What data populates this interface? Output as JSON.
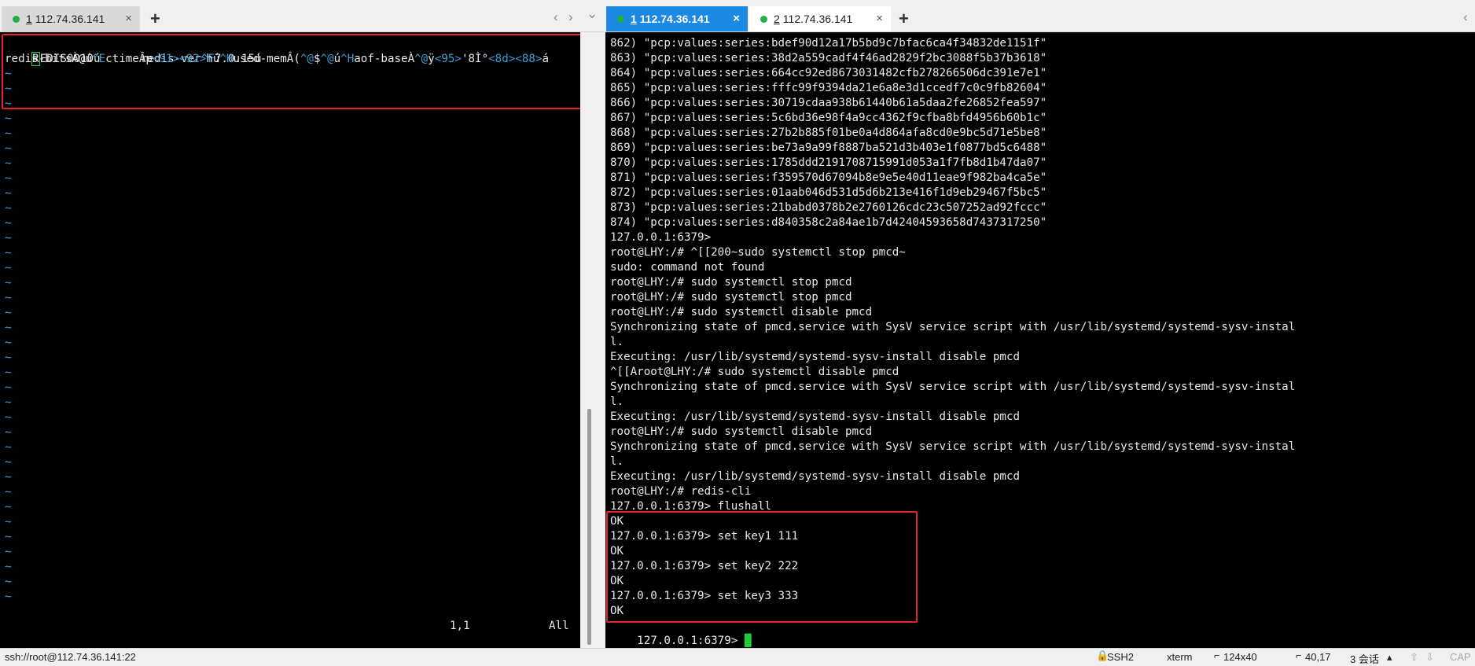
{
  "left_tabs": [
    {
      "num": "1",
      "host": "112.74.36.141",
      "close": "×"
    }
  ],
  "right_tabs": [
    {
      "num": "1",
      "host": "112.74.36.141",
      "close": "×"
    },
    {
      "num": "2",
      "host": "112.74.36.141",
      "close": "×"
    }
  ],
  "add_tab": "+",
  "nav": {
    "prev": "‹",
    "next": "›",
    "menu": "⌄"
  },
  "left_term": {
    "line1_a": "R",
    "line1_b": "EDIS0010ú      redis-ver",
    "line1_c": "^F",
    "line1_d": "7.0.15ú",
    "line2_segments": [
      {
        "t": "redis-bitsÀ@ú",
        "c": false
      },
      {
        "t": "^E",
        "c": true
      },
      {
        "t": "ctimeÂp",
        "c": false
      },
      {
        "t": "<91><92>",
        "c": true
      },
      {
        "t": "hú",
        "c": false
      },
      {
        "t": "^H",
        "c": true
      },
      {
        "t": "used-memÂ(",
        "c": false
      },
      {
        "t": "^@",
        "c": true
      },
      {
        "t": "$",
        "c": false
      },
      {
        "t": "^@",
        "c": true
      },
      {
        "t": "ú",
        "c": false
      },
      {
        "t": "^H",
        "c": true
      },
      {
        "t": "aof-baseÀ",
        "c": false
      },
      {
        "t": "^@",
        "c": true
      },
      {
        "t": "ÿ",
        "c": false
      },
      {
        "t": "<95>",
        "c": true
      },
      {
        "t": "'8Ì°",
        "c": false
      },
      {
        "t": "<8d><88>",
        "c": true
      },
      {
        "t": "á",
        "c": false
      }
    ],
    "tilde": "~",
    "tilde_count": 36,
    "ruler_pos": "1,1",
    "ruler_all": "All"
  },
  "right_term": {
    "lines": [
      "862) \"pcp:values:series:bdef90d12a17b5bd9c7bfac6ca4f34832de1151f\"",
      "863) \"pcp:values:series:38d2a559cadf4f46ad2829f2bc3088f5b37b3618\"",
      "864) \"pcp:values:series:664cc92ed8673031482cfb278266506dc391e7e1\"",
      "865) \"pcp:values:series:fffc99f9394da21e6a8e3d1ccedf7c0c9fb82604\"",
      "866) \"pcp:values:series:30719cdaa938b61440b61a5daa2fe26852fea597\"",
      "867) \"pcp:values:series:5c6bd36e98f4a9cc4362f9cfba8bfd4956b60b1c\"",
      "868) \"pcp:values:series:27b2b885f01be0a4d864afa8cd0e9bc5d71e5be8\"",
      "869) \"pcp:values:series:be73a9a99f8887ba521d3b403e1f0877bd5c6488\"",
      "870) \"pcp:values:series:1785ddd2191708715991d053a1f7fb8d1b47da07\"",
      "871) \"pcp:values:series:f359570d67094b8e9e5e40d11eae9f982ba4ca5e\"",
      "872) \"pcp:values:series:01aab046d531d5d6b213e416f1d9eb29467f5bc5\"",
      "873) \"pcp:values:series:21babd0378b2e2760126cdc23c507252ad92fccc\"",
      "874) \"pcp:values:series:d840358c2a84ae1b7d42404593658d7437317250\"",
      "127.0.0.1:6379>",
      "root@LHY:/# ^[[200~sudo systemctl stop pmcd~",
      "sudo: command not found",
      "root@LHY:/# sudo systemctl stop pmcd",
      "root@LHY:/# sudo systemctl stop pmcd",
      "root@LHY:/# sudo systemctl disable pmcd",
      "Synchronizing state of pmcd.service with SysV service script with /usr/lib/systemd/systemd-sysv-instal",
      "l.",
      "Executing: /usr/lib/systemd/systemd-sysv-install disable pmcd",
      "^[[Aroot@LHY:/# sudo systemctl disable pmcd",
      "Synchronizing state of pmcd.service with SysV service script with /usr/lib/systemd/systemd-sysv-instal",
      "l.",
      "Executing: /usr/lib/systemd/systemd-sysv-install disable pmcd",
      "root@LHY:/# sudo systemctl disable pmcd",
      "Synchronizing state of pmcd.service with SysV service script with /usr/lib/systemd/systemd-sysv-instal",
      "l.",
      "Executing: /usr/lib/systemd/systemd-sysv-install disable pmcd",
      "root@LHY:/# redis-cli",
      "127.0.0.1:6379> flushall",
      "OK",
      "127.0.0.1:6379> set key1 111",
      "OK",
      "127.0.0.1:6379> set key2 222",
      "OK",
      "127.0.0.1:6379> set key3 333",
      "OK"
    ],
    "prompt": "127.0.0.1:6379> "
  },
  "status": {
    "conn": "ssh://root@112.74.36.141:22",
    "proto": "SSH2",
    "term": "xterm",
    "size": "124x40",
    "pos": "40,17",
    "sessions": "3 会话",
    "caps": "CAP"
  },
  "colors": {
    "accent": "#1e88e5",
    "green_dot": "#1fb141",
    "highlight_box": "#e8212b"
  }
}
